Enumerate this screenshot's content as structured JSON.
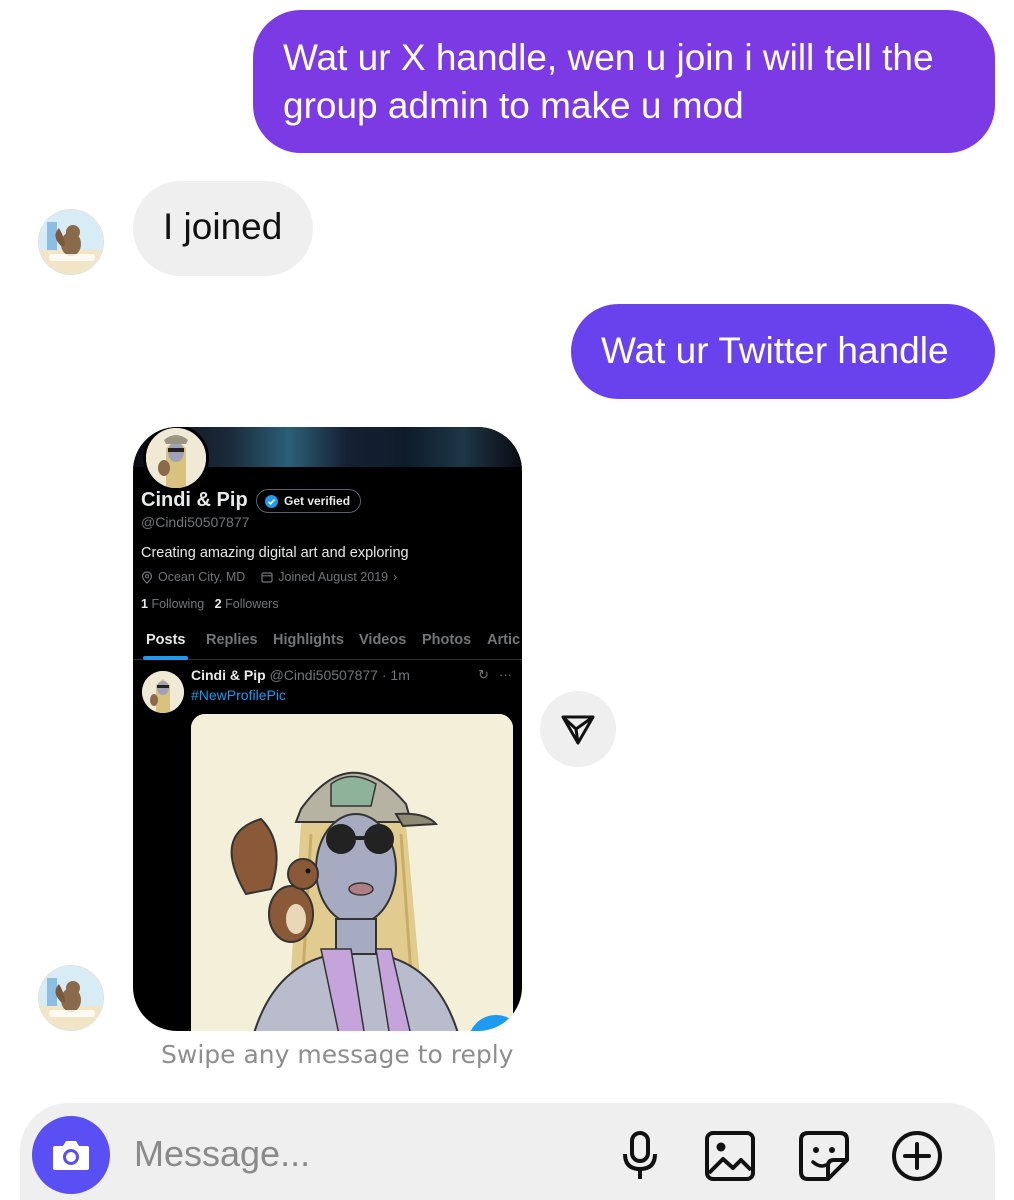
{
  "messages": [
    {
      "side": "sent",
      "text": "Wat ur X handle, wen u join i will tell the group admin to make u mod"
    },
    {
      "side": "received",
      "text": "I joined"
    },
    {
      "side": "sent",
      "text": "Wat ur Twitter handle"
    }
  ],
  "shared_profile": {
    "name": "Cindi & Pip",
    "get_verified_label": "Get verified",
    "handle": "@Cindi50507877",
    "bio": "Creating amazing digital art and exploring",
    "location": "Ocean City, MD",
    "joined": "Joined August 2019",
    "following_count": "1",
    "following_label": "Following",
    "followers_count": "2",
    "followers_label": "Followers",
    "tabs": [
      "Posts",
      "Replies",
      "Highlights",
      "Videos",
      "Photos",
      "Artic"
    ],
    "active_tab": "Posts",
    "post": {
      "author": "Cindi & Pip",
      "meta": "@Cindi50507877 · 1m",
      "hashtag": "#NewProfilePic"
    }
  },
  "swipe_hint": "Swipe any message to reply",
  "composer": {
    "placeholder": "Message..."
  },
  "icons": {
    "share": "paper-plane-icon",
    "camera": "camera-icon",
    "mic": "microphone-icon",
    "gallery": "image-icon",
    "sticker": "sticker-icon",
    "more": "plus-circle-icon"
  },
  "colors": {
    "sent_bubble_1": "#7b3ae4",
    "sent_bubble_2": "#6a42ed",
    "received_bubble": "#efefef",
    "camera_button": "#5a4ff2",
    "x_blue": "#1d9bf0"
  }
}
